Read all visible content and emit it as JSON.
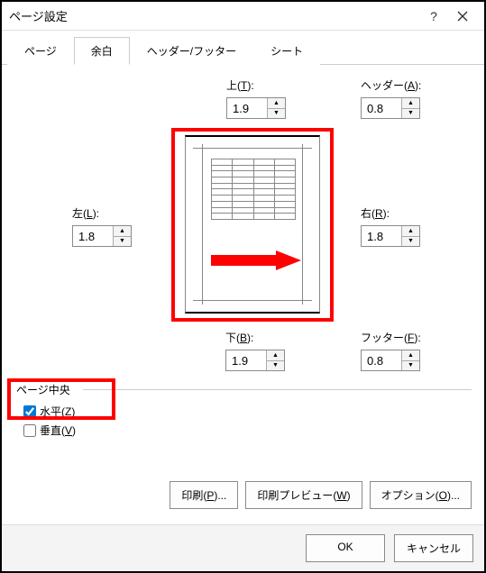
{
  "dialog": {
    "title": "ページ設定"
  },
  "tabs": [
    {
      "label": "ページ"
    },
    {
      "label": "余白"
    },
    {
      "label": "ヘッダー/フッター"
    },
    {
      "label": "シート"
    }
  ],
  "margins": {
    "top": {
      "label_prefix": "上(",
      "hotkey": "T",
      "label_suffix": "):",
      "value": "1.9"
    },
    "header": {
      "label_prefix": "ヘッダー(",
      "hotkey": "A",
      "label_suffix": "):",
      "value": "0.8"
    },
    "left": {
      "label_prefix": "左(",
      "hotkey": "L",
      "label_suffix": "):",
      "value": "1.8"
    },
    "right": {
      "label_prefix": "右(",
      "hotkey": "R",
      "label_suffix": "):",
      "value": "1.8"
    },
    "bottom": {
      "label_prefix": "下(",
      "hotkey": "B",
      "label_suffix": "):",
      "value": "1.9"
    },
    "footer": {
      "label_prefix": "フッター(",
      "hotkey": "F",
      "label_suffix": "):",
      "value": "0.8"
    }
  },
  "center_group": {
    "legend": "ページ中央",
    "horizontal": {
      "label_prefix": "水平(",
      "hotkey": "Z",
      "label_suffix": ")",
      "checked": true
    },
    "vertical": {
      "label_prefix": "垂直(",
      "hotkey": "V",
      "label_suffix": ")",
      "checked": false
    }
  },
  "buttons": {
    "print": {
      "label_prefix": "印刷(",
      "hotkey": "P",
      "label_suffix": ")..."
    },
    "preview": {
      "label_prefix": "印刷プレビュー(",
      "hotkey": "W",
      "label_suffix": ")"
    },
    "options": {
      "label_prefix": "オプション(",
      "hotkey": "O",
      "label_suffix": ")..."
    }
  },
  "footer": {
    "ok": "OK",
    "cancel": "キャンセル"
  },
  "colors": {
    "highlight": "#ff0000",
    "accent": "#0078d4"
  }
}
